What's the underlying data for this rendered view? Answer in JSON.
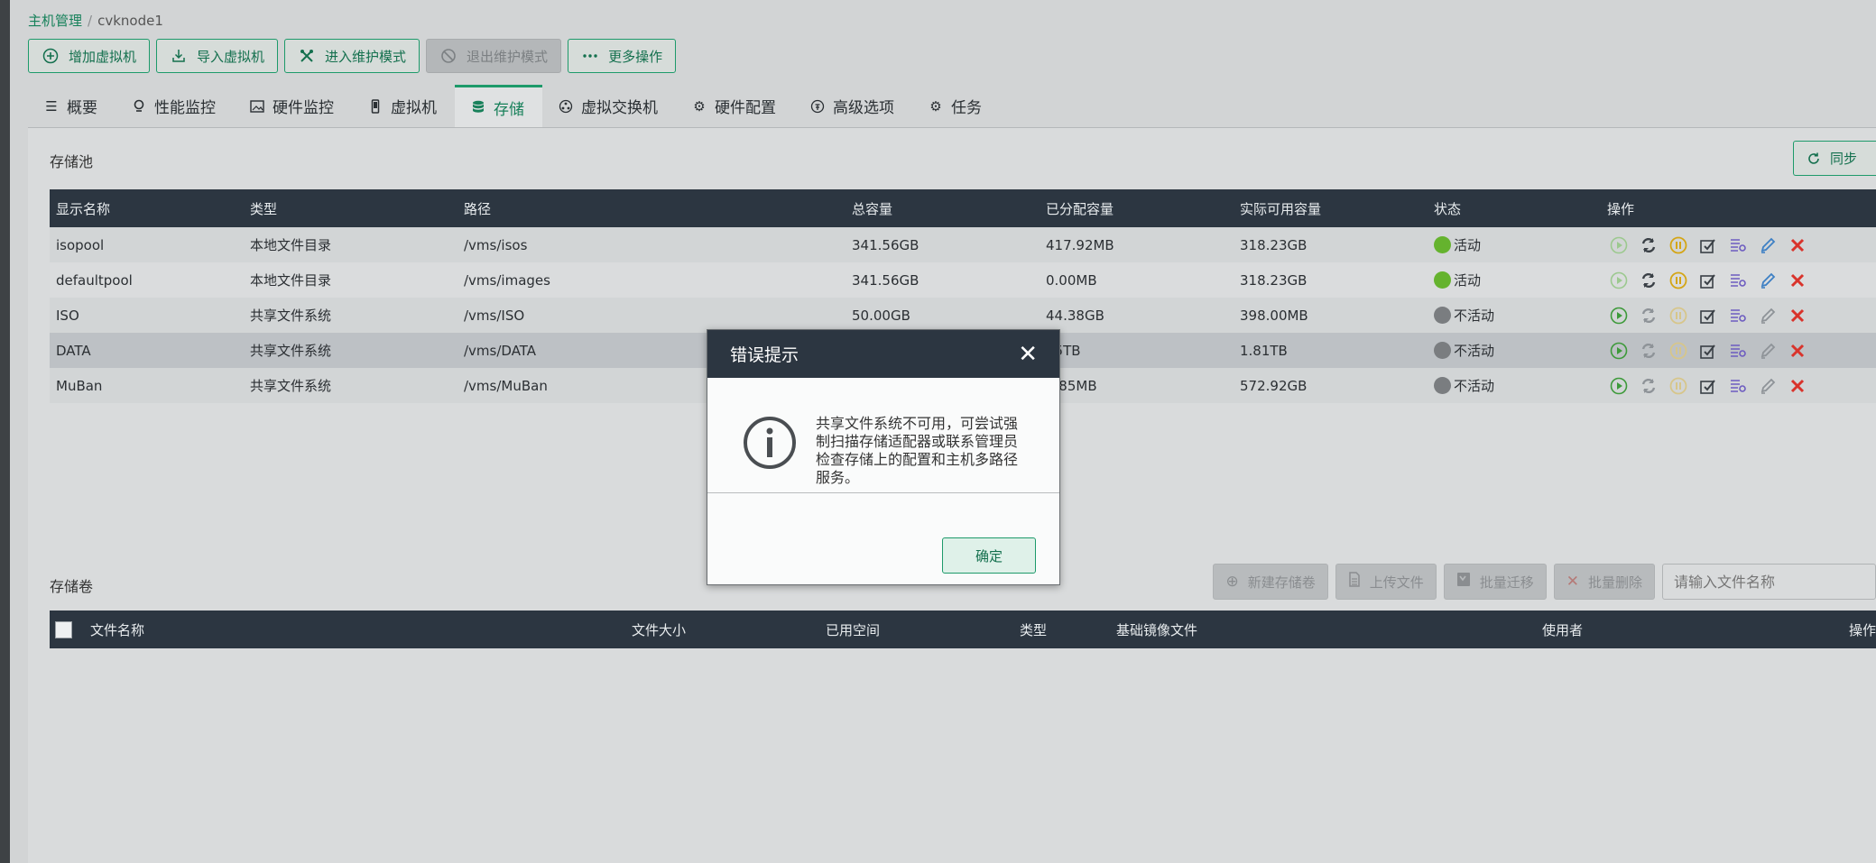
{
  "breadcrumb": {
    "root": "主机管理",
    "separator": "/",
    "current": "cvknode1"
  },
  "toolbar": {
    "add_vm": "增加虚拟机",
    "import_vm": "导入虚拟机",
    "enter_maintenance": "进入维护模式",
    "exit_maintenance": "退出维护模式",
    "more_actions": "更多操作"
  },
  "tabs": [
    "概要",
    "性能监控",
    "硬件监控",
    "虚拟机",
    "存储",
    "虚拟交换机",
    "硬件配置",
    "高级选项",
    "任务"
  ],
  "active_tab": "存储",
  "storage_pool": {
    "title": "存储池",
    "sync_label": "同步",
    "columns": [
      "显示名称",
      "类型",
      "路径",
      "总容量",
      "已分配容量",
      "实际可用容量",
      "状态",
      "操作"
    ],
    "rows": [
      {
        "name": "isopool",
        "type": "本地文件目录",
        "path": "/vms/isos",
        "total": "341.56GB",
        "allocated": "417.92MB",
        "available": "318.23GB",
        "status": "活动",
        "state": "active"
      },
      {
        "name": "defaultpool",
        "type": "本地文件目录",
        "path": "/vms/images",
        "total": "341.56GB",
        "allocated": "0.00MB",
        "available": "318.23GB",
        "status": "活动",
        "state": "active"
      },
      {
        "name": "ISO",
        "type": "共享文件系统",
        "path": "/vms/ISO",
        "total": "50.00GB",
        "allocated": "44.38GB",
        "available": "398.00MB",
        "status": "不活动",
        "state": "inactive"
      },
      {
        "name": "DATA",
        "type": "共享文件系统",
        "path": "/vms/DATA",
        "total": "",
        "allocated": "75TB",
        "available": "1.81TB",
        "status": "不活动",
        "state": "inactive"
      },
      {
        "name": "MuBan",
        "type": "共享文件系统",
        "path": "/vms/MuBan",
        "total": "",
        "allocated": "4.85MB",
        "available": "572.92GB",
        "status": "不活动",
        "state": "inactive"
      }
    ]
  },
  "storage_volume": {
    "title": "存储卷",
    "new_volume": "新建存储卷",
    "upload_file": "上传文件",
    "batch_migrate": "批量迁移",
    "batch_delete": "批量删除",
    "search_placeholder": "请输入文件名称",
    "columns": [
      "文件名称",
      "文件大小",
      "已用空间",
      "类型",
      "基础镜像文件",
      "使用者",
      "操作"
    ]
  },
  "modal": {
    "title": "错误提示",
    "close": "✕",
    "message": "共享文件系统不可用，可尝试强制扫描存储适配器或联系管理员检查存储上的配置和主机多路径服务。",
    "ok": "确定"
  },
  "colors": {
    "accent": "#1d9a6a",
    "header_dark": "#2c3641",
    "status_active": "#65b32e",
    "status_inactive": "#7a7d80",
    "delete_red": "#d9332b"
  }
}
